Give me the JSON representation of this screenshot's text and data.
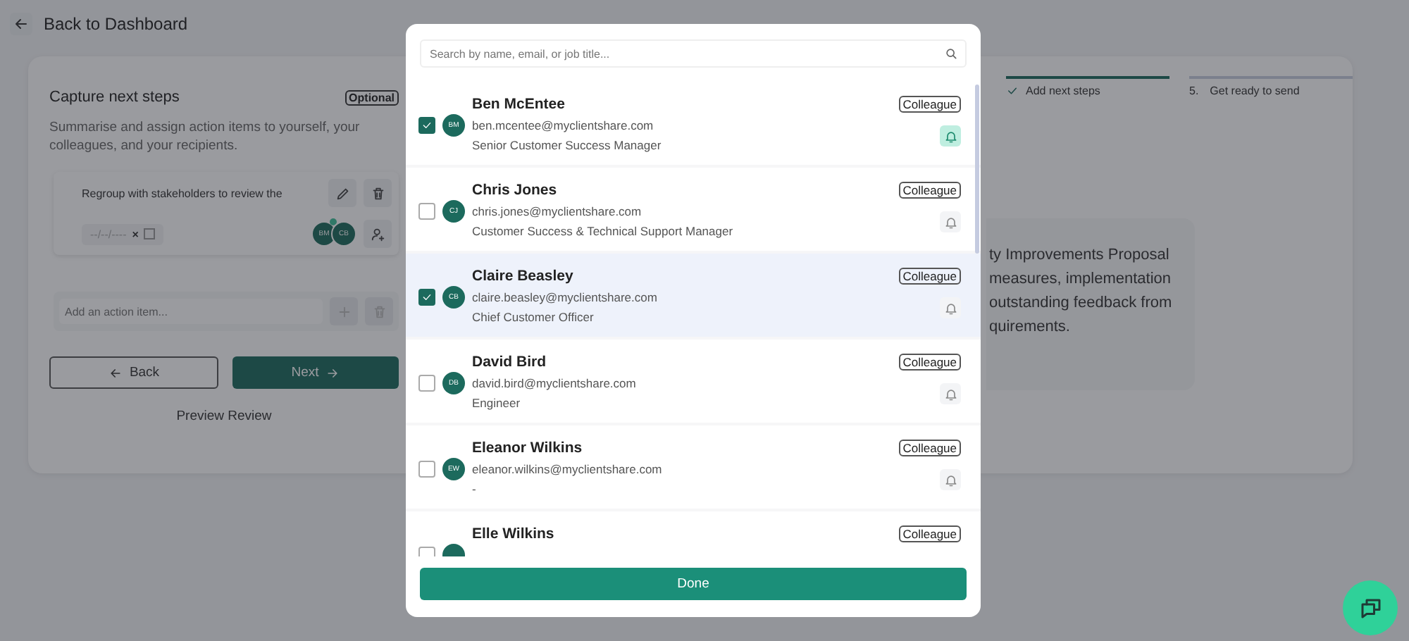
{
  "header": {
    "back_label": "Back to Dashboard"
  },
  "capture": {
    "title": "Capture next steps",
    "badge": "Optional",
    "description": "Summarise and assign action items to yourself, your colleagues, and your recipients.",
    "action_item": {
      "text": "Regroup with stakeholders to review the",
      "date_placeholder": "--/--/----",
      "clear": "×",
      "checked": false,
      "assignees": [
        "BM",
        "CB"
      ]
    },
    "add_placeholder": "Add an action item...",
    "back_button": "Back",
    "next_button": "Next",
    "preview_link": "Preview Review"
  },
  "steps": [
    {
      "label": "Add next steps",
      "done": true
    },
    {
      "number": "5.",
      "label": "Get ready to send",
      "done": false
    }
  ],
  "summary_lines": [
    "ty Improvements Proposal",
    "measures, implementation",
    "outstanding feedback from",
    "quirements."
  ],
  "modal": {
    "search_placeholder": "Search by name, email, or job title...",
    "people": [
      {
        "name": "Ben McEntee",
        "initials": "BM",
        "email": "ben.mcentee@myclientshare.com",
        "title": "Senior Customer Success Manager",
        "tag": "Colleague",
        "checked": true,
        "notify": true,
        "selected": false
      },
      {
        "name": "Chris Jones",
        "initials": "CJ",
        "email": "chris.jones@myclientshare.com",
        "title": "Customer Success & Technical Support Manager",
        "tag": "Colleague",
        "checked": false,
        "notify": false,
        "selected": false
      },
      {
        "name": "Claire Beasley",
        "initials": "CB",
        "email": "claire.beasley@myclientshare.com",
        "title": "Chief Customer Officer",
        "tag": "Colleague",
        "checked": true,
        "notify": false,
        "selected": true
      },
      {
        "name": "David Bird",
        "initials": "DB",
        "email": "david.bird@myclientshare.com",
        "title": "Engineer",
        "tag": "Colleague",
        "checked": false,
        "notify": false,
        "selected": false
      },
      {
        "name": "Eleanor Wilkins",
        "initials": "EW",
        "email": "eleanor.wilkins@myclientshare.com",
        "title": "-",
        "tag": "Colleague",
        "checked": false,
        "notify": false,
        "selected": false
      },
      {
        "name": "Elle Wilkins",
        "tag": "Colleague",
        "checked": false,
        "selected": false
      }
    ],
    "done_button": "Done"
  }
}
